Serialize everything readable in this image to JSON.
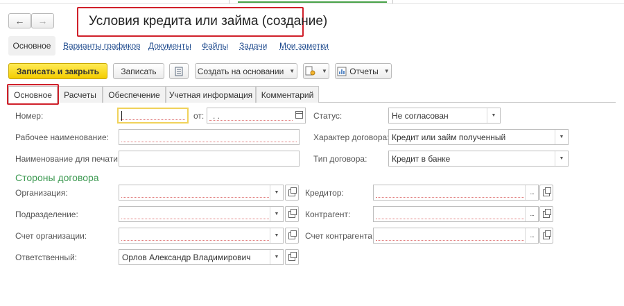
{
  "nav": {
    "back": "←",
    "forward": "→"
  },
  "window": {
    "title": "Условия кредита или займа (создание)"
  },
  "sections": [
    {
      "label": "Основное"
    },
    {
      "label": "Варианты графиков"
    },
    {
      "label": "Документы"
    },
    {
      "label": "Файлы"
    },
    {
      "label": "Задачи"
    },
    {
      "label": "Мои заметки"
    }
  ],
  "toolbar": {
    "save_close": "Записать и закрыть",
    "save": "Записать",
    "create_based": "Создать на основании",
    "reports": "Отчеты"
  },
  "tabs": [
    {
      "label": "Основное"
    },
    {
      "label": "Расчеты"
    },
    {
      "label": "Обеспечение"
    },
    {
      "label": "Учетная информация"
    },
    {
      "label": "Комментарий"
    }
  ],
  "form": {
    "number_label": "Номер:",
    "number_value": "",
    "from_label": "от:",
    "date_placeholder": ".  .",
    "status_label": "Статус:",
    "status_value": "Не согласован",
    "work_name_label": "Рабочее наименование:",
    "work_name_value": "",
    "contract_nature_label": "Характер договора:",
    "contract_nature_value": "Кредит или займ полученный",
    "print_name_label": "Наименование для печати:",
    "print_name_value": "",
    "contract_type_label": "Тип договора:",
    "contract_type_value": "Кредит в банке",
    "parties_heading": "Стороны договора",
    "organization_label": "Организация:",
    "organization_value": "",
    "creditor_label": "Кредитор:",
    "creditor_value": "",
    "division_label": "Подразделение:",
    "division_value": "",
    "counterparty_label": "Контрагент:",
    "counterparty_value": "",
    "org_account_label": "Счет организации:",
    "org_account_value": "",
    "counterparty_account_label": "Счет контрагента:",
    "counterparty_account_value": "",
    "responsible_label": "Ответственный:",
    "responsible_value": "Орлов Александр Владимирович"
  },
  "colors": {
    "primary_button": "#f4cd00",
    "highlight": "#d0202a",
    "section_heading": "#3e9a53",
    "link": "#1f4b8e"
  }
}
